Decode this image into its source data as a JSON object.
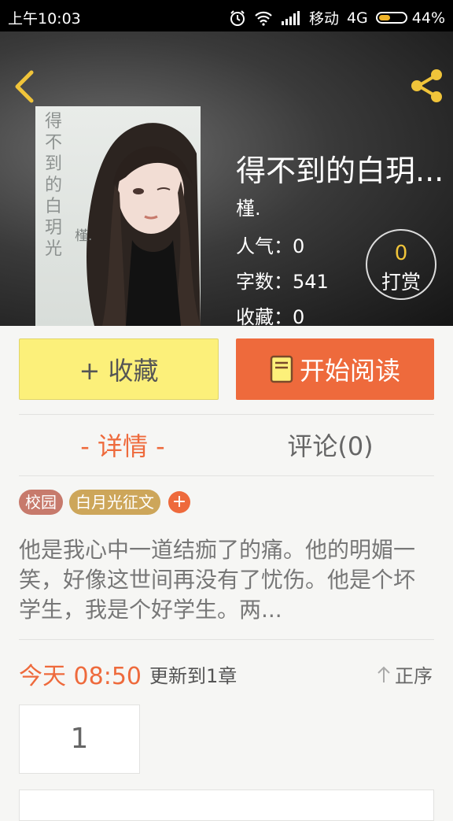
{
  "status_bar": {
    "time": "上午10:03",
    "carrier": "移动",
    "network": "4G",
    "battery": "44%",
    "battery_level": 0.44
  },
  "header": {
    "back_icon": "chevron-left-icon",
    "share_icon": "share-icon"
  },
  "book": {
    "cover_title": "得不到的白玥光",
    "cover_author": "槿.",
    "title": "得不到的白玥...",
    "author": "槿.",
    "popularity": "人气：0",
    "word_count": "字数：541",
    "favorites": "收藏：0"
  },
  "tip": {
    "count": "0",
    "label": "打赏"
  },
  "actions": {
    "favorite_label": "+ 收藏",
    "read_label": "开始阅读"
  },
  "tabs": {
    "detail": "- 详情 -",
    "comments": "评论(0)"
  },
  "tags": [
    "校园",
    "白月光征文"
  ],
  "tag_add": "+",
  "intro": "他是我心中一道结痂了的痛。他的明媚一笑，好像这世间再没有了忧伤。他是个坏学生，我是个好学生。两...",
  "update": {
    "time": "今天 08:50",
    "text": "更新到1章",
    "sort_label": "正序"
  },
  "chapters": [
    "1"
  ],
  "colors": {
    "accent": "#ee6a3c",
    "favorite_bg": "#fcf07a",
    "tag_1": "#c77a6c",
    "tag_2": "#cda65a",
    "icon_yellow": "#f0c43a"
  }
}
